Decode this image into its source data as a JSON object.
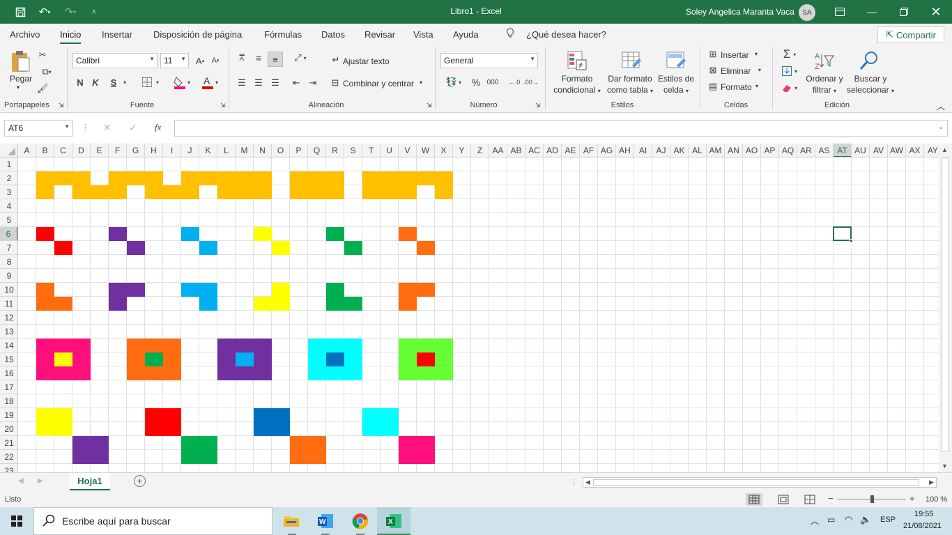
{
  "titlebar": {
    "title": "Libro1  -  Excel",
    "user": "Soley Angelica Maranta Vaca",
    "initials": "SA",
    "accent": "#217346"
  },
  "tabs": [
    "Archivo",
    "Inicio",
    "Insertar",
    "Disposición de página",
    "Fórmulas",
    "Datos",
    "Revisar",
    "Vista",
    "Ayuda"
  ],
  "tellme": "¿Qué desea hacer?",
  "share": "Compartir",
  "ribbon": {
    "paste": "Pegar",
    "font_name": "Calibri",
    "font_size": "11",
    "bold": "N",
    "italic": "K",
    "underline": "S",
    "wrap": "Ajustar texto",
    "merge": "Combinar y centrar",
    "number_format": "General",
    "percent": "%",
    "thousands": "000",
    "cond_format": [
      "Formato",
      "condicional"
    ],
    "format_table": [
      "Dar formato",
      "como tabla"
    ],
    "cell_styles": [
      "Estilos de",
      "celda"
    ],
    "insert": "Insertar",
    "delete": "Eliminar",
    "format": "Formato",
    "sort": [
      "Ordenar y",
      "filtrar"
    ],
    "find": [
      "Buscar y",
      "seleccionar"
    ],
    "groups": [
      "Portapapeles",
      "Fuente",
      "Alineación",
      "Número",
      "Estilos",
      "Celdas",
      "Edición"
    ]
  },
  "formula": {
    "namebox": "AT6",
    "fx": "fx",
    "value": ""
  },
  "columns": [
    "A",
    "B",
    "C",
    "D",
    "E",
    "F",
    "G",
    "H",
    "I",
    "J",
    "K",
    "L",
    "M",
    "N",
    "O",
    "P",
    "Q",
    "R",
    "S",
    "T",
    "U",
    "V",
    "W",
    "X",
    "Y",
    "Z",
    "AA",
    "AB",
    "AC",
    "AD",
    "AE",
    "AF",
    "AG",
    "AH",
    "AI",
    "AJ",
    "AK",
    "AL",
    "AM",
    "AN",
    "AO",
    "AP",
    "AQ",
    "AR",
    "AS",
    "AT",
    "AU",
    "AV",
    "AW",
    "AX",
    "AY"
  ],
  "rows": [
    "1",
    "2",
    "3",
    "4",
    "5",
    "6",
    "7",
    "8",
    "9",
    "10",
    "11",
    "12",
    "13",
    "14",
    "15",
    "16",
    "17",
    "18",
    "19",
    "20",
    "21",
    "22",
    "23"
  ],
  "selected_cell": "AT6",
  "cell_fills": [
    {
      "range": "B2:D2",
      "color": "#FFC000"
    },
    {
      "range": "F2:H2",
      "color": "#FFC000"
    },
    {
      "range": "J2:N2",
      "color": "#FFC000"
    },
    {
      "range": "P2:R2",
      "color": "#FFC000"
    },
    {
      "range": "T2:X2",
      "color": "#FFC000"
    },
    {
      "range": "B3",
      "color": "#FFC000"
    },
    {
      "range": "D3:F3",
      "color": "#FFC000"
    },
    {
      "range": "H3:J3",
      "color": "#FFC000"
    },
    {
      "range": "L3:N3",
      "color": "#FFC000"
    },
    {
      "range": "P3:R3",
      "color": "#FFC000"
    },
    {
      "range": "T3:V3",
      "color": "#FFC000"
    },
    {
      "range": "X3",
      "color": "#FFC000"
    },
    {
      "range": "B6",
      "color": "#FF0000"
    },
    {
      "range": "C7",
      "color": "#FF0000"
    },
    {
      "range": "F6",
      "color": "#7030A0"
    },
    {
      "range": "G7",
      "color": "#7030A0"
    },
    {
      "range": "J6",
      "color": "#00B0F0"
    },
    {
      "range": "K7",
      "color": "#00B0F0"
    },
    {
      "range": "N6",
      "color": "#FFFF00"
    },
    {
      "range": "O7",
      "color": "#FFFF00"
    },
    {
      "range": "R6",
      "color": "#00B050"
    },
    {
      "range": "S7",
      "color": "#00B050"
    },
    {
      "range": "V6",
      "color": "#FF6D10"
    },
    {
      "range": "W7",
      "color": "#FF6D10"
    },
    {
      "range": "B10",
      "color": "#FF6D10"
    },
    {
      "range": "B11:C11",
      "color": "#FF6D10"
    },
    {
      "range": "F10:G10",
      "color": "#7030A0"
    },
    {
      "range": "F11",
      "color": "#7030A0"
    },
    {
      "range": "J10:K10",
      "color": "#00B0F0"
    },
    {
      "range": "K11",
      "color": "#00B0F0"
    },
    {
      "range": "O10",
      "color": "#FFFF00"
    },
    {
      "range": "N11:O11",
      "color": "#FFFF00"
    },
    {
      "range": "R10",
      "color": "#00B050"
    },
    {
      "range": "R11:S11",
      "color": "#00B050"
    },
    {
      "range": "V10:W10",
      "color": "#FF6D10"
    },
    {
      "range": "V11",
      "color": "#FF6D10"
    },
    {
      "range": "B14:D16",
      "color": "#FF0F7B"
    },
    {
      "range": "C15",
      "color": "#FFFF00"
    },
    {
      "range": "G14:I16",
      "color": "#FF6D10"
    },
    {
      "range": "H15",
      "color": "#00B050"
    },
    {
      "range": "L14:N16",
      "color": "#7030A0"
    },
    {
      "range": "M15",
      "color": "#00B0F0"
    },
    {
      "range": "Q14:S16",
      "color": "#00FFFF"
    },
    {
      "range": "R15",
      "color": "#0070C0"
    },
    {
      "range": "V14:X16",
      "color": "#66FF33"
    },
    {
      "range": "W15",
      "color": "#FF0000"
    },
    {
      "range": "B19:C20",
      "color": "#FFFF00"
    },
    {
      "range": "H19:I20",
      "color": "#FF0000"
    },
    {
      "range": "N19:O20",
      "color": "#0070C0"
    },
    {
      "range": "T19:U20",
      "color": "#00FFFF"
    },
    {
      "range": "D21:E22",
      "color": "#7030A0"
    },
    {
      "range": "J21:K22",
      "color": "#00B050"
    },
    {
      "range": "P21:Q22",
      "color": "#FF6D10"
    },
    {
      "range": "V21:W22",
      "color": "#FF0F7B"
    }
  ],
  "sheet": {
    "tab": "Hoja1"
  },
  "status": {
    "text": "Listo",
    "zoom": "100 %"
  },
  "taskbar": {
    "search_placeholder": "Escribe aquí para buscar",
    "lang": "ESP",
    "time": "19:55",
    "date": "21/08/2021"
  }
}
